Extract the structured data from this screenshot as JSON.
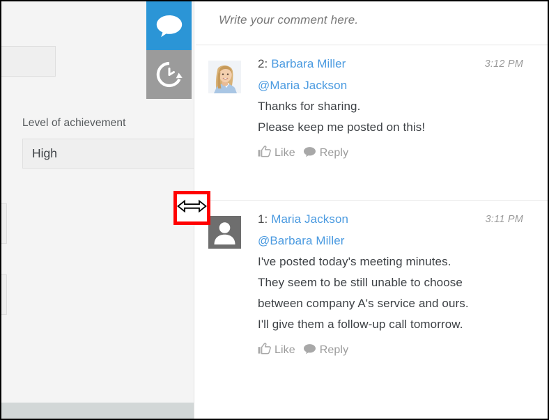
{
  "form_panel": {
    "field_label": "Level of achievement",
    "field_value": "High"
  },
  "tabs": [
    {
      "name": "comment-tab",
      "icon": "speech-bubble-icon",
      "active": true,
      "color": "#2b95d6"
    },
    {
      "name": "history-tab",
      "icon": "history-clock-icon",
      "active": false,
      "color": "#9b9b9b"
    }
  ],
  "comment_input": {
    "placeholder": "Write your comment here."
  },
  "comments": [
    {
      "number": "2:",
      "author": "Barbara Miller",
      "time": "3:12 PM",
      "mention": "@Maria Jackson",
      "lines": [
        "Thanks for sharing.",
        "Please keep me posted on this!"
      ],
      "avatar_type": "photo",
      "like_label": "Like",
      "reply_label": "Reply"
    },
    {
      "number": "1:",
      "author": "Maria Jackson",
      "time": "3:11 PM",
      "mention": "@Barbara Miller",
      "lines": [
        "I've posted today's meeting minutes.",
        "They seem to be still unable to choose",
        "between company A's service and ours.",
        "I'll give them a follow-up call tomorrow."
      ],
      "avatar_type": "default",
      "like_label": "Like",
      "reply_label": "Reply"
    }
  ],
  "callout": {
    "icon": "horizontal-resize-arrow-icon",
    "border_color": "#ff0000"
  },
  "colors": {
    "accent_blue": "#2b95d6",
    "link_blue": "#4a9ae0",
    "tab_gray": "#9b9b9b",
    "panel_bg": "#f4f4f4",
    "footer_bar": "#d2d7d7",
    "callout_red": "#ff0000"
  }
}
